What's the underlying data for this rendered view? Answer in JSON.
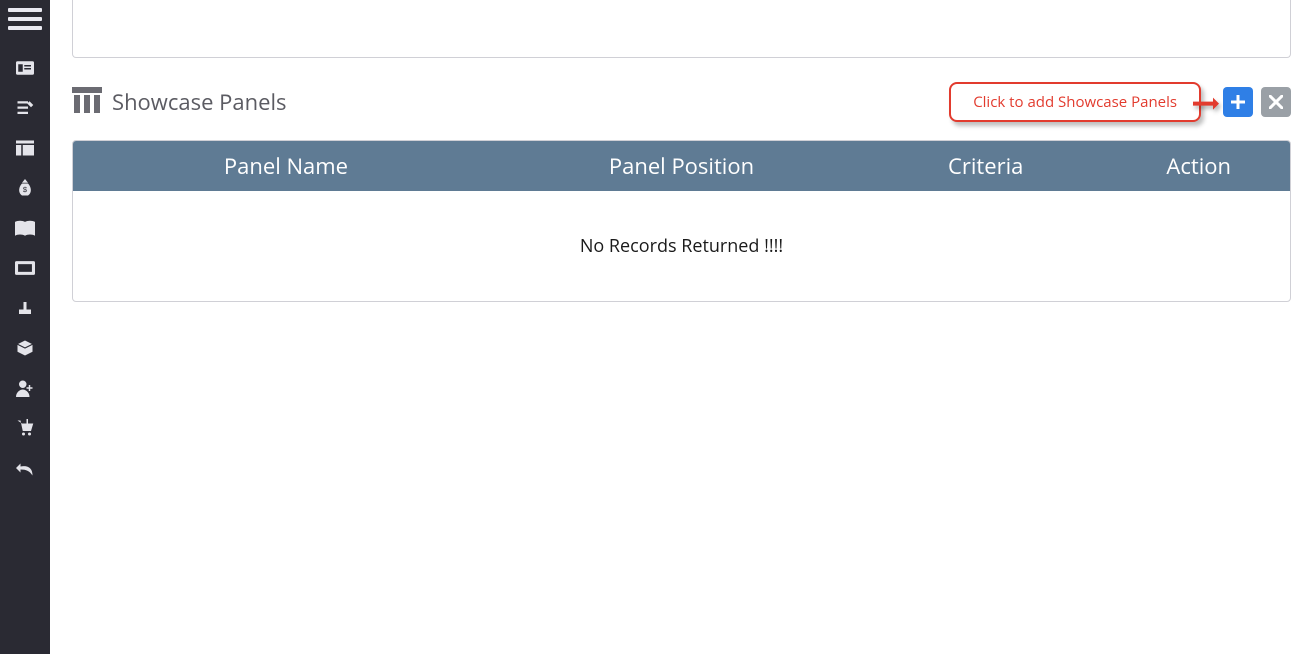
{
  "section": {
    "title": "Showcase Panels"
  },
  "callout": {
    "text": "Click to add Showcase Panels"
  },
  "table": {
    "headers": {
      "name": "Panel Name",
      "position": "Panel Position",
      "criteria": "Criteria",
      "action": "Action"
    },
    "empty_message": "No Records Returned !!!!"
  }
}
